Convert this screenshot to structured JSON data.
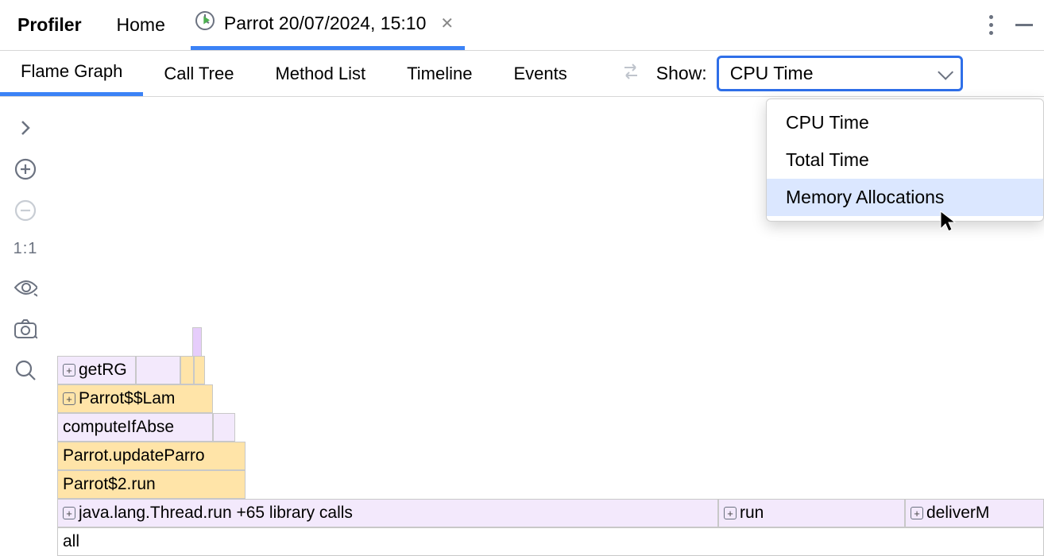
{
  "header": {
    "title": "Profiler",
    "home": "Home",
    "active_tab": "Parrot 20/07/2024, 15:10"
  },
  "toolbar": {
    "tabs": [
      "Flame Graph",
      "Call Tree",
      "Method List",
      "Timeline",
      "Events"
    ],
    "show_label": "Show:"
  },
  "show_select": {
    "selected": "CPU Time",
    "options": [
      "CPU Time",
      "Total Time",
      "Memory Allocations"
    ],
    "highlighted_index": 2
  },
  "rail": {
    "ratio_label": "1:1"
  },
  "flame": {
    "all": "all",
    "threadrun": "java.lang.Thread.run  +65 library calls",
    "run": "run",
    "deliver": "deliverM",
    "parrot2run": "Parrot$2.run",
    "updateParrot": "Parrot.updateParro",
    "computeIfAbse": "computeIfAbse",
    "parrotLam": "Parrot$$Lam",
    "getRG": "getRG"
  }
}
